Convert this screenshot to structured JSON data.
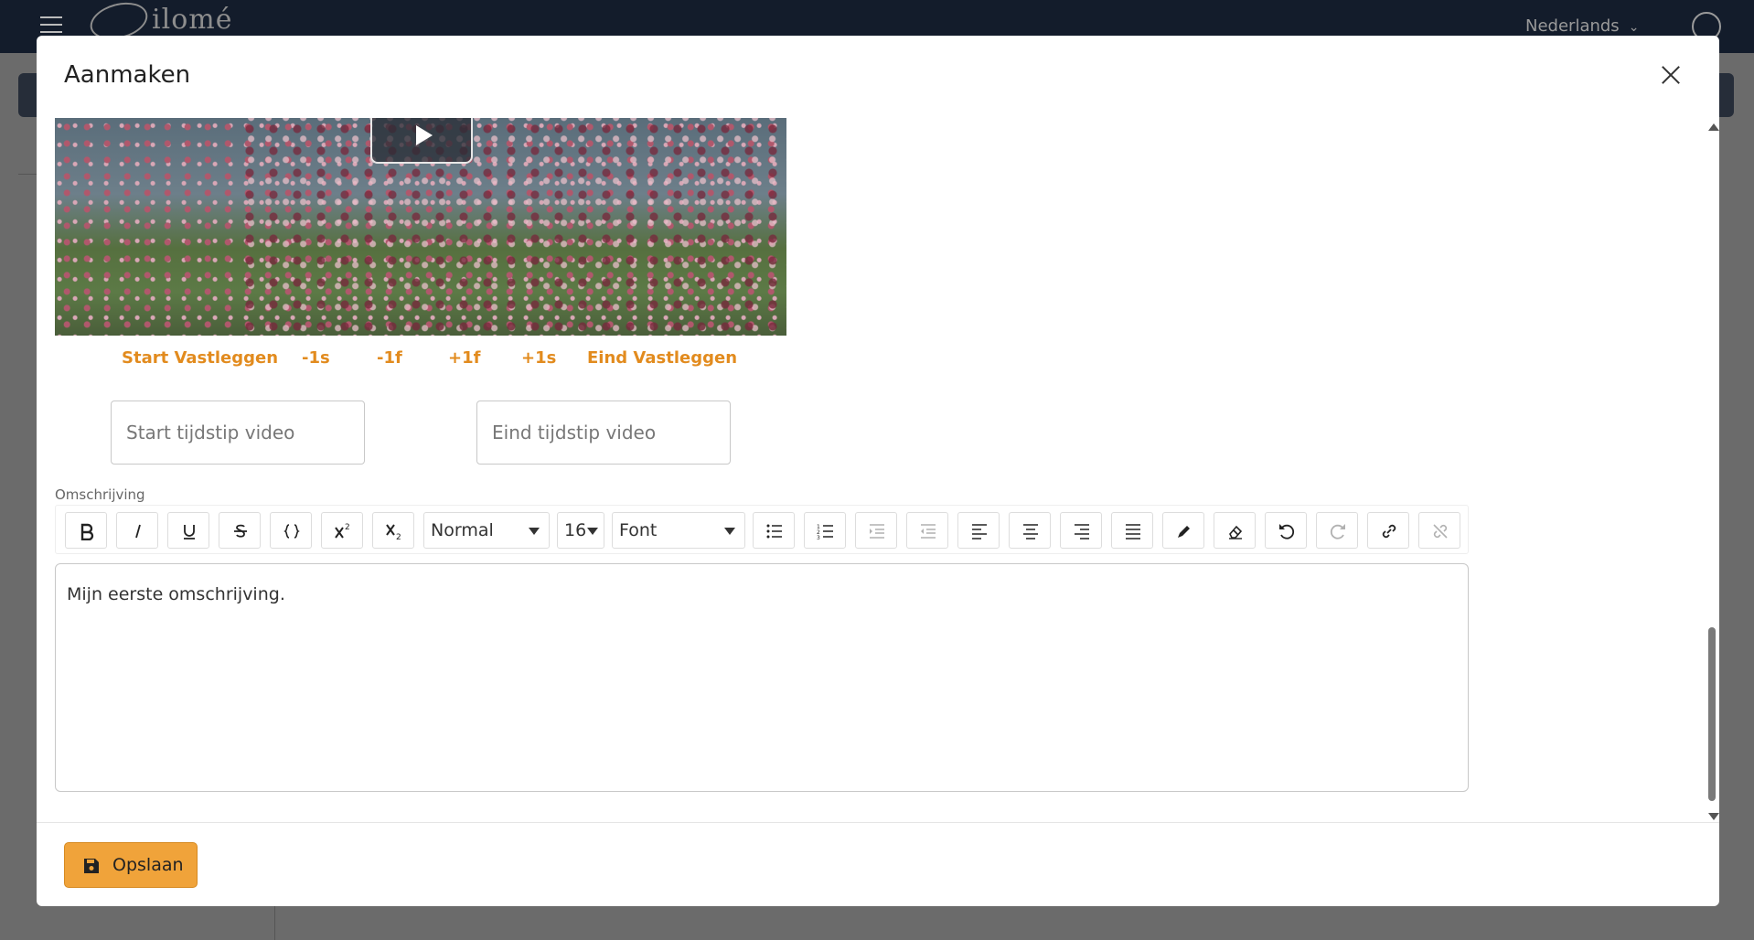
{
  "app": {
    "logo_text": "ilomé",
    "language": "Nederlands"
  },
  "modal": {
    "title": "Aanmaken",
    "video_controls": [
      "Start Vastleggen",
      "-1s",
      "-1f",
      "+1f",
      "+1s",
      "Eind Vastleggen"
    ],
    "start_time": {
      "value": "",
      "placeholder": "Start tijdstip video"
    },
    "end_time": {
      "value": "",
      "placeholder": "Eind tijdstip video"
    },
    "description_label": "Omschrijving",
    "toolbar": {
      "heading_select": "Normal",
      "size_select": "16",
      "font_select": "Font"
    },
    "editor_text": "Mijn eerste omschrijving.",
    "save_label": "Opslaan"
  },
  "colors": {
    "accent": "#e28b1e",
    "save_bg": "#f0a33a",
    "topbar": "#131c2b"
  }
}
